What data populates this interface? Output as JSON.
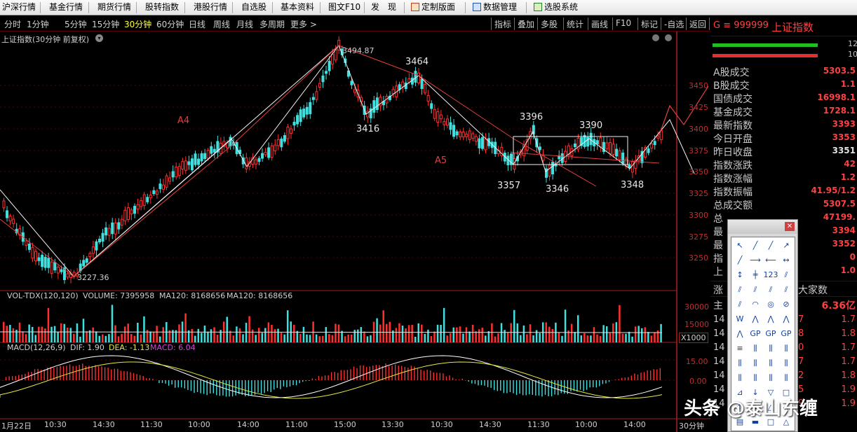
{
  "menu": [
    "沪深行情",
    "基金行情",
    "期货行情",
    "股转指数",
    "港股行情",
    "自选股",
    "基本资料",
    "图文F10",
    "发",
    "现",
    "定制版面",
    "数据管理",
    "选股系统"
  ],
  "periods": [
    "分时",
    "1分钟",
    "5分钟",
    "15分钟",
    "30分钟",
    "60分钟",
    "日线",
    "周线",
    "月线",
    "多周期",
    "更多 >"
  ],
  "active_period": "30分钟",
  "tools": [
    "指标",
    "叠加",
    "多股",
    "统计",
    "画线",
    "F10",
    "标记",
    "-自选",
    "返回"
  ],
  "chart": {
    "title": "上证指数(30分钟 前复权)",
    "price_levels": [
      "3450",
      "3425",
      "3400",
      "3375",
      "3350",
      "3325",
      "3300",
      "3275",
      "3250"
    ],
    "annotations": {
      "peak_high": "3494.87",
      "low": "3227.36",
      "a4": "A4",
      "a5": "A5",
      "p3464": "3464",
      "p3416": "3416",
      "p3396": "3396",
      "p3390": "3390",
      "p3357": "3357",
      "p3346": "3346",
      "p3348": "3348"
    }
  },
  "volume": {
    "title": "VOL-TDX(120,120)",
    "volume_label": "VOLUME: 7395958",
    "ma1_label": "MA120: 8168656",
    "ma2_label": "MA120: 8168656",
    "axis": [
      "30000",
      "15000"
    ],
    "unit": "X1000"
  },
  "macd": {
    "title": "MACD(12,26,9)",
    "dif": "DIF: 1.90",
    "dea": "DEA: -1.13",
    "macd": "MACD: 6.04",
    "axis": [
      "15.00",
      "0.00"
    ]
  },
  "time_axis": [
    "1月22日",
    "10:30",
    "14:30",
    "11:30",
    "10:00",
    "14:00",
    "11:00",
    "15:00",
    "13:30",
    "10:30",
    "14:30",
    "11:30",
    "10:00",
    "14:00"
  ],
  "period_tag": "30分钟",
  "quote": {
    "code": "G ≡ 999999",
    "name": "上证指数",
    "top_right1": "12",
    "top_right2": "10",
    "rows": [
      {
        "label": "A股成交",
        "value": "5303.5"
      },
      {
        "label": "B股成交",
        "value": "1.1"
      },
      {
        "label": "国债成交",
        "value": "16998.1"
      },
      {
        "label": "基金成交",
        "value": "1728.1"
      },
      {
        "label": "最新指数",
        "value": "3393"
      },
      {
        "label": "今日开盘",
        "value": "3353"
      },
      {
        "label": "昨日收盘",
        "value": "3351"
      },
      {
        "label": "指数涨跌",
        "value": "42"
      },
      {
        "label": "指数涨幅",
        "value": "1.2"
      },
      {
        "label": "指数振幅",
        "value": "41.95/1.2"
      },
      {
        "label": "总成交额",
        "value": "5307.5"
      },
      {
        "label": "总",
        "value": "47199."
      },
      {
        "label": "最",
        "value": "3394"
      },
      {
        "label": "最",
        "value": "3352"
      },
      {
        "label": "指",
        "value": "0"
      },
      {
        "label": "上",
        "value": "1.0"
      }
    ],
    "fund_flow_label": "涨",
    "fund_flow_title": "大家数",
    "main_label": "主",
    "main_value": "6.36亿",
    "tick_rows": [
      {
        "t": "14",
        "v": "7",
        "p": "1.7"
      },
      {
        "t": "14",
        "v": "8",
        "p": "1.8"
      },
      {
        "t": "14",
        "v": "0",
        "p": "1.7"
      },
      {
        "t": "14",
        "v": "7",
        "p": "1.7"
      },
      {
        "t": "14",
        "v": "2",
        "p": "1.8"
      },
      {
        "t": "14",
        "v": "5",
        "p": "1.9"
      },
      {
        "t": "14",
        "v": "9",
        "p": "1.9"
      }
    ]
  },
  "watermark": "头条 @泰山东缠",
  "colors": {
    "up": "#ff3030",
    "down": "#40e0e0",
    "axis": "#a02020",
    "ma": "#ffffff"
  }
}
